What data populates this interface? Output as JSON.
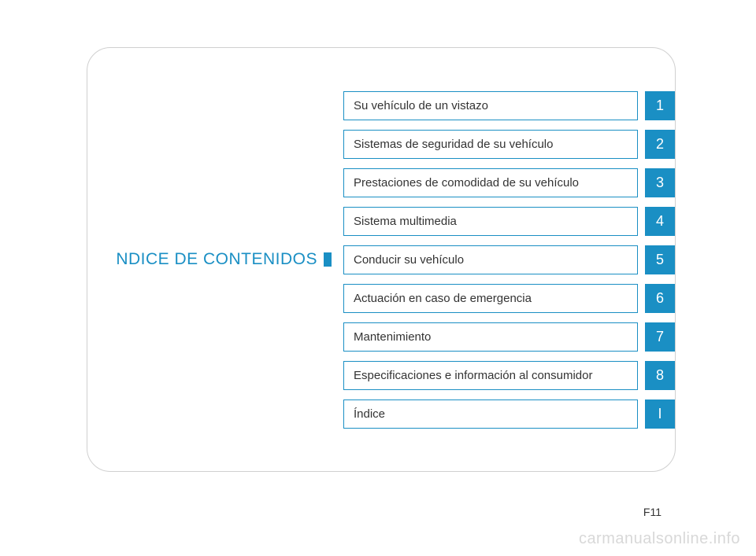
{
  "title": "NDICE DE CONTENIDOS",
  "toc": {
    "items": [
      {
        "label": "Su vehículo de un vistazo",
        "number": "1"
      },
      {
        "label": "Sistemas de seguridad de su vehículo",
        "number": "2"
      },
      {
        "label": "Prestaciones de comodidad de su vehículo",
        "number": "3"
      },
      {
        "label": "Sistema multimedia",
        "number": "4"
      },
      {
        "label": "Conducir su vehículo",
        "number": "5"
      },
      {
        "label": "Actuación en caso de emergencia",
        "number": "6"
      },
      {
        "label": "Mantenimiento",
        "number": "7"
      },
      {
        "label": "Especificaciones e información al consumidor",
        "number": "8"
      },
      {
        "label": "Índice",
        "number": "I"
      }
    ]
  },
  "page_number": "F11",
  "watermark": "carmanualsonline.info"
}
